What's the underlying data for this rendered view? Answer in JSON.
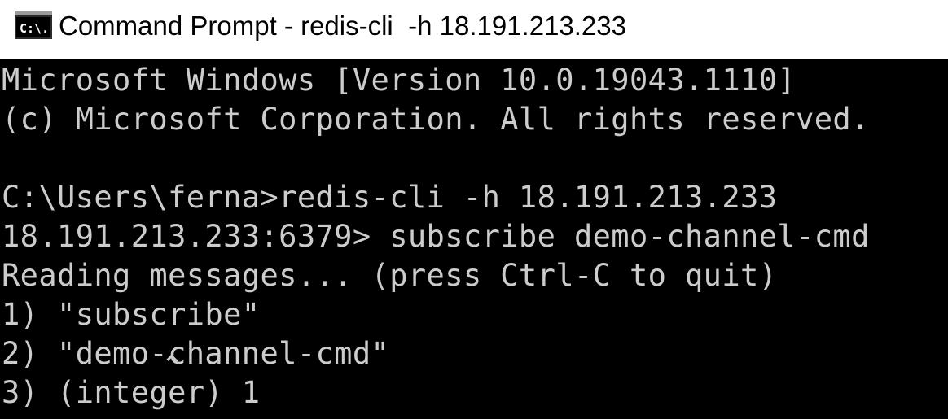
{
  "window": {
    "title": "Command Prompt - redis-cli  -h 18.191.213.233",
    "icon": "cmd-console-icon",
    "icon_label": "C:\\."
  },
  "console": {
    "background": "#000000",
    "foreground": "#cccccc",
    "lines": [
      "Microsoft Windows [Version 10.0.19043.1110]",
      "(c) Microsoft Corporation. All rights reserved.",
      "",
      "C:\\Users\\ferna>redis-cli -h 18.191.213.233",
      "18.191.213.233:6379> subscribe demo-channel-cmd",
      "Reading messages... (press Ctrl-C to quit)",
      "1) \"subscribe\"",
      "2) \"demo-channel-cmd\"",
      "3) (integer) 1"
    ]
  }
}
